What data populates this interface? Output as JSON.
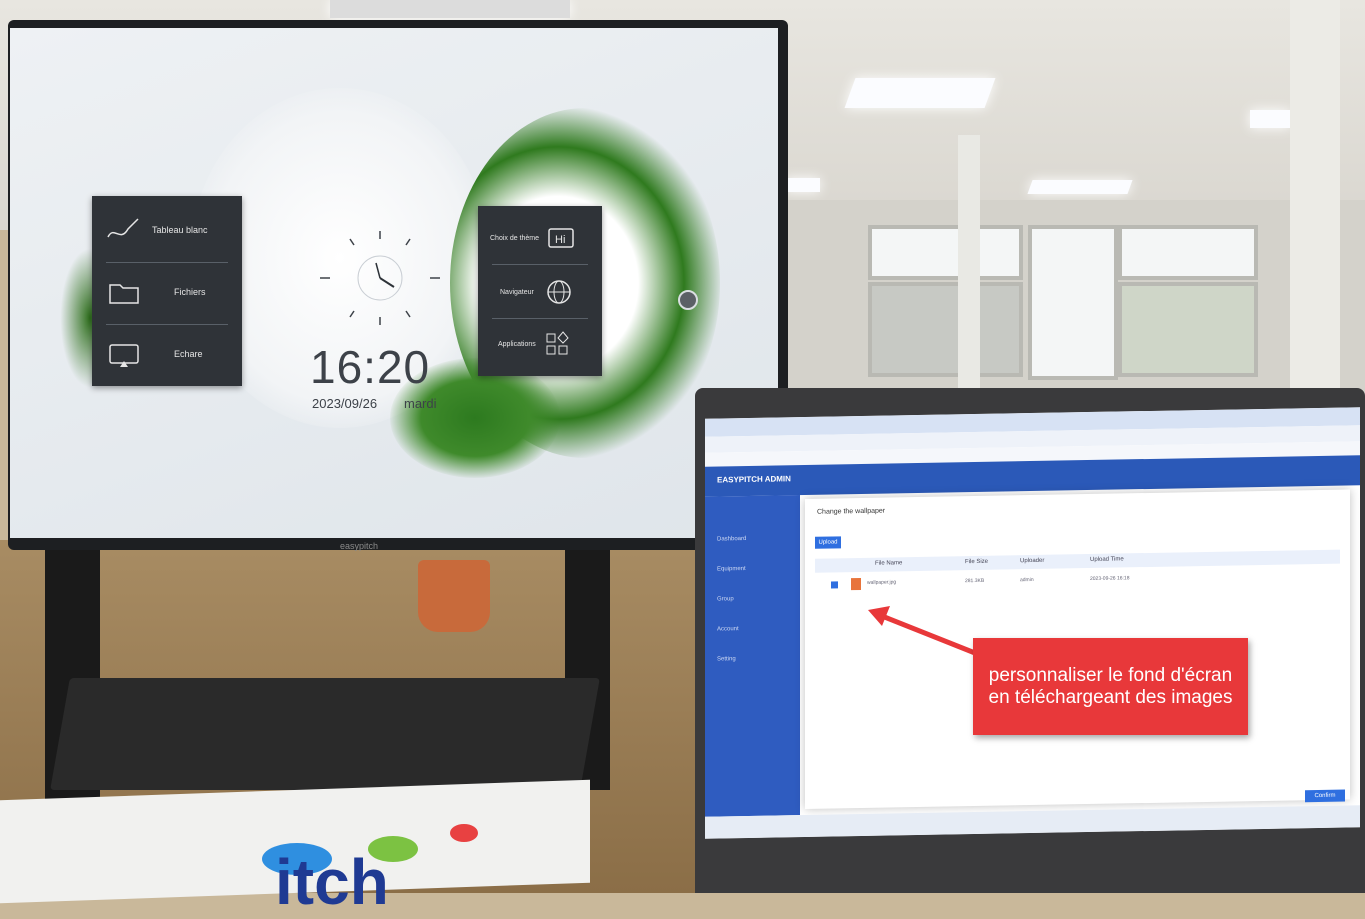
{
  "display": {
    "brand": "easypitch",
    "left_panel": [
      {
        "label": "Tableau blanc",
        "icon": "pen-icon"
      },
      {
        "label": "Fichiers",
        "icon": "folder-icon"
      },
      {
        "label": "Echare",
        "icon": "screen-share-icon"
      }
    ],
    "right_panel": [
      {
        "label": "Choix de thème",
        "icon": "hi-icon"
      },
      {
        "label": "Navigateur",
        "icon": "globe-icon"
      },
      {
        "label": "Applications",
        "icon": "apps-icon"
      }
    ],
    "clock": {
      "time": "16:20",
      "date": "2023/09/26",
      "day": "mardi"
    }
  },
  "laptop": {
    "app_title": "EASYPITCH ADMIN",
    "dialog": {
      "title": "Change the wallpaper",
      "upload_label": "Upload",
      "columns": [
        "File Name",
        "File Size",
        "Uploader",
        "Upload Time"
      ],
      "row": {
        "name": "wallpaper.jpg",
        "size": "281.3KB",
        "uploader": "admin",
        "time": "2023-09-26 16:18"
      },
      "ok_label": "Confirm"
    },
    "sidebar": [
      "Dashboard",
      "Equipment",
      "Group",
      "Account",
      "Setting"
    ]
  },
  "annotation": {
    "text": "personnaliser le fond d'écran en téléchargeant des images",
    "color": "#e8383a"
  },
  "cardboard": {
    "logo_text": "itch"
  }
}
